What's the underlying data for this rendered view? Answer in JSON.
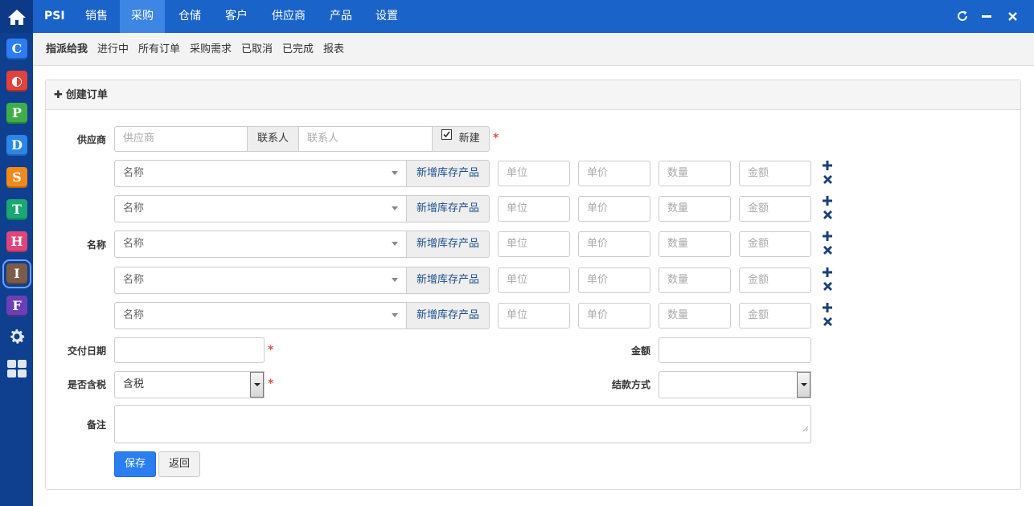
{
  "app": {
    "brand": "PSI"
  },
  "dock": {
    "apps": [
      {
        "glyph": "C",
        "color": "#2c7cf6"
      },
      {
        "glyph": "◐",
        "color": "#e2423a"
      },
      {
        "glyph": "P",
        "color": "#3fae49"
      },
      {
        "glyph": "D",
        "color": "#2a86e8"
      },
      {
        "glyph": "S",
        "color": "#f08a1c"
      },
      {
        "glyph": "T",
        "color": "#1aa772"
      },
      {
        "glyph": "H",
        "color": "#e0457b"
      },
      {
        "glyph": "I",
        "color": "#7b5c4a"
      },
      {
        "glyph": "F",
        "color": "#6b3fb5"
      }
    ]
  },
  "topnav": {
    "items": [
      {
        "label": "销售"
      },
      {
        "label": "采购"
      },
      {
        "label": "仓储"
      },
      {
        "label": "客户"
      },
      {
        "label": "供应商"
      },
      {
        "label": "产品"
      },
      {
        "label": "设置"
      }
    ],
    "active": "采购"
  },
  "subnav": {
    "items": [
      {
        "label": "指派给我"
      },
      {
        "label": "进行中"
      },
      {
        "label": "所有订单"
      },
      {
        "label": "采购需求"
      },
      {
        "label": "已取消"
      },
      {
        "label": "已完成"
      },
      {
        "label": "报表"
      }
    ]
  },
  "panel": {
    "title": "创建订单"
  },
  "form": {
    "supplier_label": "供应商",
    "supplier_placeholder": "供应商",
    "contact_addon": "联系人",
    "contact_placeholder": "联系人",
    "new_checkbox_label": "新建",
    "required_mark": "*",
    "name_label": "名称",
    "product_rows": [
      {
        "name_placeholder": "名称",
        "add_stock_label": "新增库存产品",
        "unit_placeholder": "单位",
        "price_placeholder": "单价",
        "qty_placeholder": "数量",
        "amount_placeholder": "金额"
      },
      {
        "name_placeholder": "名称",
        "add_stock_label": "新增库存产品",
        "unit_placeholder": "单位",
        "price_placeholder": "单价",
        "qty_placeholder": "数量",
        "amount_placeholder": "金额"
      },
      {
        "name_placeholder": "名称",
        "add_stock_label": "新增库存产品",
        "unit_placeholder": "单位",
        "price_placeholder": "单价",
        "qty_placeholder": "数量",
        "amount_placeholder": "金额"
      },
      {
        "name_placeholder": "名称",
        "add_stock_label": "新增库存产品",
        "unit_placeholder": "单位",
        "price_placeholder": "单价",
        "qty_placeholder": "数量",
        "amount_placeholder": "金额"
      },
      {
        "name_placeholder": "名称",
        "add_stock_label": "新增库存产品",
        "unit_placeholder": "单位",
        "price_placeholder": "单价",
        "qty_placeholder": "数量",
        "amount_placeholder": "金额"
      }
    ],
    "delivery_label": "交付日期",
    "amount_label": "金额",
    "tax_label": "是否含税",
    "tax_value": "含税",
    "payment_label": "结款方式",
    "notes_label": "备注",
    "save_label": "保存",
    "back_label": "返回"
  },
  "colors": {
    "accent": "#1a63c9",
    "dock": "#0f3f8f",
    "required": "#d9534f"
  }
}
